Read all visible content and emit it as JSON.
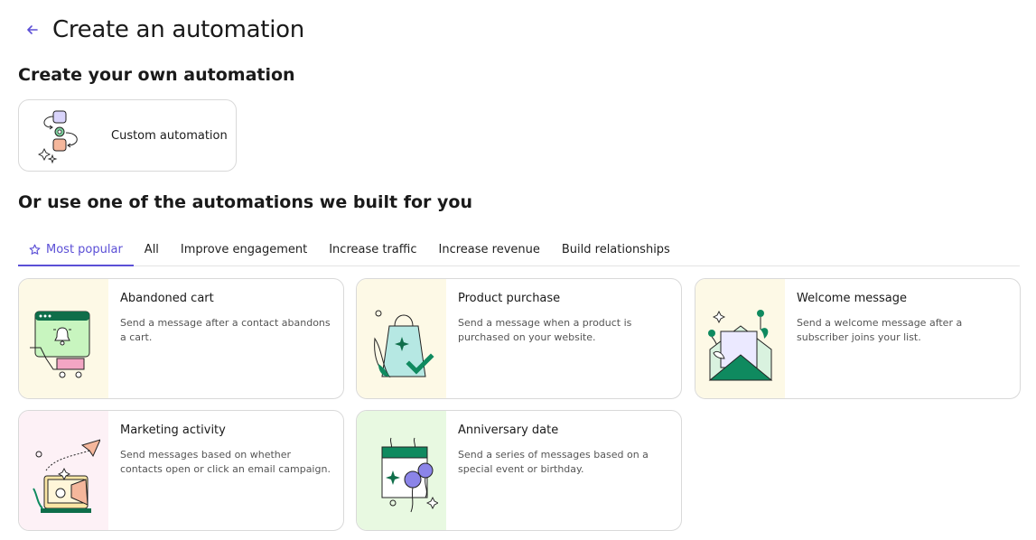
{
  "header": {
    "title": "Create an automation",
    "back_icon": "arrow-left-icon"
  },
  "own_section": {
    "title": "Create your own automation",
    "custom_card": {
      "label": "Custom automation",
      "icon": "workflow-illustration"
    }
  },
  "built_section": {
    "title": "Or use one of the automations we built for you"
  },
  "tabs": [
    {
      "label": "Most popular",
      "icon": "star-icon",
      "active": true
    },
    {
      "label": "All",
      "active": false
    },
    {
      "label": "Improve engagement",
      "active": false
    },
    {
      "label": "Increase traffic",
      "active": false
    },
    {
      "label": "Increase revenue",
      "active": false
    },
    {
      "label": "Build relationships",
      "active": false
    }
  ],
  "cards": [
    {
      "title": "Abandoned cart",
      "description": "Send a message after a contact abandons a cart.",
      "illustration": "shopping-cart-browser-illustration",
      "panel_color": "#fdf9e6"
    },
    {
      "title": "Product purchase",
      "description": "Send a message when a product is purchased on your website.",
      "illustration": "shopping-bag-check-illustration",
      "panel_color": "#fdf9e6"
    },
    {
      "title": "Welcome message",
      "description": "Send a welcome message after a subscriber joins your list.",
      "illustration": "open-envelope-illustration",
      "panel_color": "#fdf9e6"
    },
    {
      "title": "Marketing activity",
      "description": "Send messages based on whether contacts open or click an email campaign.",
      "illustration": "megaphone-paper-plane-illustration",
      "panel_color": "#fdf1f6"
    },
    {
      "title": "Anniversary date",
      "description": "Send a series of messages based on a special event or birthday.",
      "illustration": "calendar-balloons-illustration",
      "panel_color": "#e8f9e1"
    }
  ],
  "colors": {
    "accent": "#5b4fd6",
    "brand_green": "#0f8a5f"
  }
}
